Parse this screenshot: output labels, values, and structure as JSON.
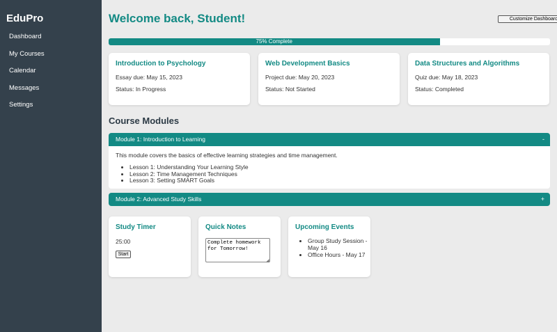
{
  "sidebar": {
    "brand": "EduPro",
    "items": [
      {
        "label": "Dashboard"
      },
      {
        "label": "My Courses"
      },
      {
        "label": "Calendar"
      },
      {
        "label": "Messages"
      },
      {
        "label": "Settings"
      }
    ]
  },
  "header": {
    "welcome": "Welcome back, Student!",
    "customize_label": "Customize Dashboard"
  },
  "progress": {
    "label": "75% Complete",
    "value": 0.75
  },
  "courses": [
    {
      "title": "Introduction to Psychology",
      "due": "Essay due: May 15, 2023",
      "status": "Status: In Progress"
    },
    {
      "title": "Web Development Basics",
      "due": "Project due: May 20, 2023",
      "status": "Status: Not Started"
    },
    {
      "title": "Data Structures and Algorithms",
      "due": "Quiz due: May 18, 2023",
      "status": "Status: Completed"
    }
  ],
  "modules": {
    "section_title": "Course Modules",
    "items": [
      {
        "title": "Module 1: Introduction to Learning",
        "toggle": "-",
        "expanded": true,
        "description": "This module covers the basics of effective learning strategies and time management.",
        "lessons": [
          "Lesson 1: Understanding Your Learning Style",
          "Lesson 2: Time Management Techniques",
          "Lesson 3: Setting SMART Goals"
        ]
      },
      {
        "title": "Module 2: Advanced Study Skills",
        "toggle": "+",
        "expanded": false
      }
    ]
  },
  "widgets": {
    "timer": {
      "title": "Study Timer",
      "value": "25:00",
      "start_label": "Start"
    },
    "notes": {
      "title": "Quick Notes",
      "value": "Complete homework for Tomorrow!"
    },
    "events": {
      "title": "Upcoming Events",
      "items": [
        "Group Study Session - May 16",
        "Office Hours - May 17"
      ]
    }
  },
  "colors": {
    "accent": "#138a84",
    "sidebar_bg": "#34414c",
    "page_bg": "#ebebeb"
  }
}
